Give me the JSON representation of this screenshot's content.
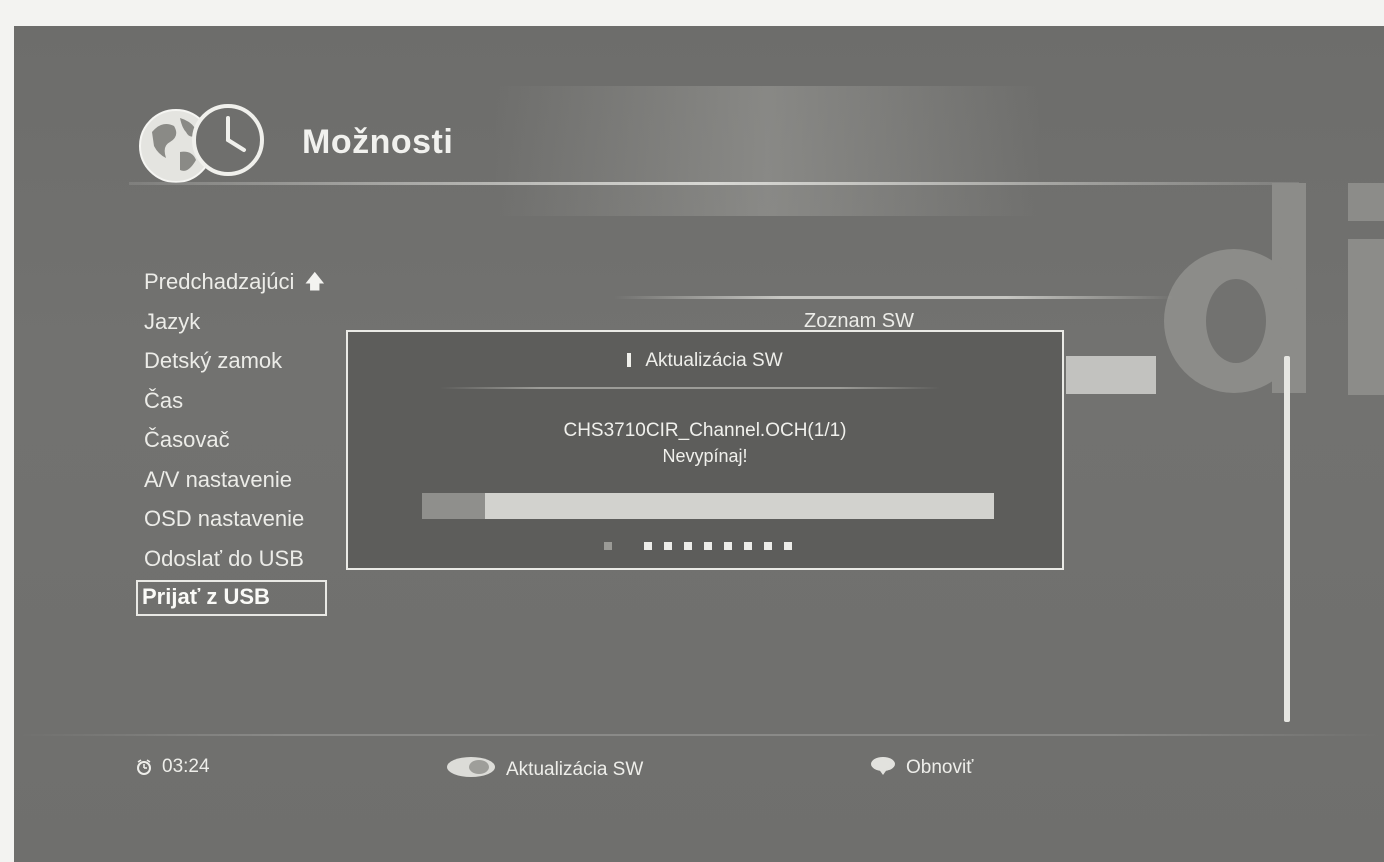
{
  "header": {
    "title": "Možnosti",
    "logo_icon": "globe-clock-icon"
  },
  "menu": {
    "items": [
      {
        "label": "Predchadzajúci",
        "icon": "arrow-up-icon"
      },
      {
        "label": "Jazyk"
      },
      {
        "label": "Detský zamok"
      },
      {
        "label": "Čas"
      },
      {
        "label": "Časovač"
      },
      {
        "label": "A/V nastavenie"
      },
      {
        "label": "OSD nastavenie"
      },
      {
        "label": "Odoslať do USB"
      },
      {
        "label": "Prijať z USB",
        "selected": true
      }
    ]
  },
  "sw_list": {
    "label": "Zoznam SW"
  },
  "dialog": {
    "title": "Aktualizácia SW",
    "icon": "info-icon",
    "file_line": "CHS3710CIR_Channel.OCH(1/1)",
    "warning": "Nevypínaj!",
    "progress_fraction": 0.11,
    "dots_total": 9,
    "dots_active_from": 2
  },
  "footer": {
    "time": "03:24",
    "update_label": "Aktualizácia SW",
    "refresh_label": "Obnoviť",
    "clock_icon": "alarm-clock-icon",
    "update_key_icon": "ok-key-icon",
    "refresh_key_icon": "color-key-icon"
  }
}
